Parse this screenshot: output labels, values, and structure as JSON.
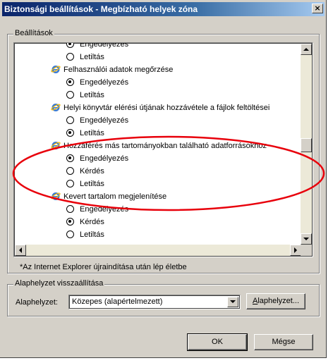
{
  "window": {
    "title": "Biztonsági beállítások - Megbízható helyek zóna",
    "close_glyph": "×"
  },
  "settings_group": {
    "legend": "Beállítások",
    "rows": [
      {
        "kind": "option",
        "label": "Engedélyezés",
        "checked": true
      },
      {
        "kind": "option",
        "label": "Letiltás",
        "checked": false
      },
      {
        "kind": "heading",
        "label": "Felhasználói adatok megőrzése"
      },
      {
        "kind": "option",
        "label": "Engedélyezés",
        "checked": true
      },
      {
        "kind": "option",
        "label": "Letiltás",
        "checked": false
      },
      {
        "kind": "heading",
        "label": "Helyi könyvtár elérési útjának hozzávétele a fájlok feltöltései"
      },
      {
        "kind": "option",
        "label": "Engedélyezés",
        "checked": false
      },
      {
        "kind": "option",
        "label": "Letiltás",
        "checked": true
      },
      {
        "kind": "heading",
        "label": "Hozzáférés más tartományokban található adatforrásokhoz"
      },
      {
        "kind": "option",
        "label": "Engedélyezés",
        "checked": true
      },
      {
        "kind": "option",
        "label": "Kérdés",
        "checked": false
      },
      {
        "kind": "option",
        "label": "Letiltás",
        "checked": false
      },
      {
        "kind": "heading",
        "label": "Kevert tartalom megjelenítése"
      },
      {
        "kind": "option",
        "label": "Engedélyezés",
        "checked": false
      },
      {
        "kind": "option",
        "label": "Kérdés",
        "checked": true
      },
      {
        "kind": "option",
        "label": "Letiltás",
        "checked": false
      }
    ]
  },
  "note": "*Az Internet Explorer újraindítása után lép életbe",
  "reset_group": {
    "legend": "Alaphelyzet visszaállítása",
    "label_prefix": "Alaphelyzet",
    "label_suffix": ":",
    "selected_value": "Közepes (alapértelmezett)",
    "reset_button_accel": "A",
    "reset_button_rest": "laphelyzet..."
  },
  "buttons": {
    "ok": "OK",
    "cancel": "Mégse"
  },
  "colors": {
    "dialog_bg": "#d4d0c8",
    "title_start": "#0a246a",
    "title_end": "#a6caf0",
    "annotation": "#e8000b"
  },
  "annotation": {
    "shape": "ellipse",
    "color": "#e8000b",
    "target": "Hozzáférés más tartományokban található adatforrásokhoz"
  }
}
